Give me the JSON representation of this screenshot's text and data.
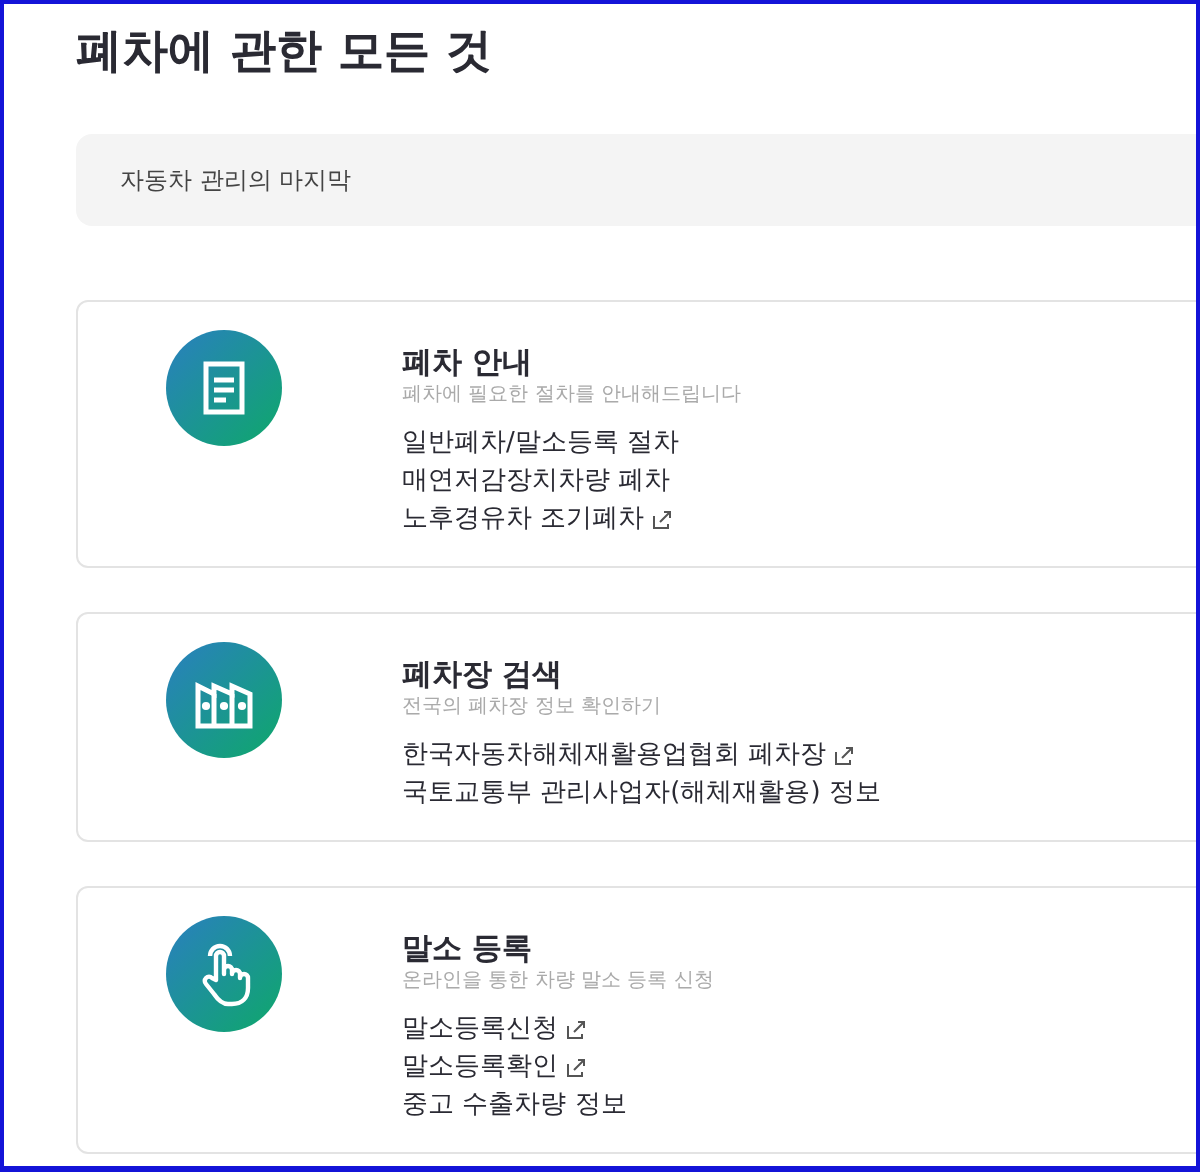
{
  "title": "폐차에 관한 모든 것",
  "banner": "자동차 관리의 마지막",
  "sections": [
    {
      "kind": "document",
      "heading": "폐차 안내",
      "subtitle": "폐차에 필요한 절차를 안내해드립니다",
      "links": [
        {
          "label": "일반폐차/말소등록 절차",
          "external": false
        },
        {
          "label": "매연저감장치차량 폐차",
          "external": false
        },
        {
          "label": "노후경유차 조기폐차",
          "external": true
        }
      ]
    },
    {
      "kind": "factory",
      "heading": "폐차장 검색",
      "subtitle": "전국의 폐차장 정보 확인하기",
      "links": [
        {
          "label": "한국자동차해체재활용업협회 폐차장",
          "external": true
        },
        {
          "label": "국토교통부 관리사업자(해체재활용) 정보",
          "external": false
        }
      ]
    },
    {
      "kind": "hand",
      "heading": "말소 등록",
      "subtitle": "온라인을 통한 차량 말소 등록 신청",
      "links": [
        {
          "label": "말소등록신청",
          "external": true
        },
        {
          "label": "말소등록확인",
          "external": true
        },
        {
          "label": "중고 수출차량 정보",
          "external": false
        }
      ]
    }
  ]
}
